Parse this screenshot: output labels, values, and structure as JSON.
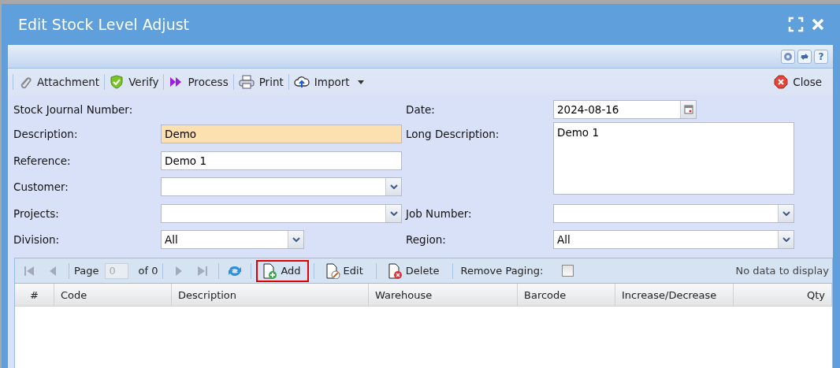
{
  "window": {
    "title": "Edit Stock Level Adjust"
  },
  "header_tools": [
    {
      "kind": "settings"
    },
    {
      "kind": "refresh"
    },
    {
      "kind": "help",
      "label": "?"
    }
  ],
  "toolbar": {
    "items": [
      {
        "kind": "attachment",
        "label": "Attachment"
      },
      {
        "kind": "verify",
        "label": "Verify"
      },
      {
        "kind": "process",
        "label": "Process"
      },
      {
        "kind": "print",
        "label": "Print"
      },
      {
        "kind": "import",
        "label": "Import"
      }
    ],
    "close": {
      "label": "Close"
    }
  },
  "form": {
    "left": [
      {
        "label": "Stock Journal Number:",
        "kind": "none"
      },
      {
        "label": "Description:",
        "kind": "text",
        "value": "Demo",
        "required": true
      },
      {
        "label": "Reference:",
        "kind": "text",
        "value": "Demo 1",
        "required": false
      },
      {
        "label": "Customer:",
        "kind": "combo",
        "required": false
      },
      {
        "label": "Projects:",
        "kind": "combo",
        "required": false
      },
      {
        "label": "Division:",
        "kind": "combo",
        "value": "All",
        "required": false
      }
    ],
    "right": [
      {
        "label": "Date:",
        "kind": "date",
        "value": "2024-08-16"
      },
      {
        "label": "Long Description:",
        "kind": "textarea",
        "value": "Demo 1"
      },
      {
        "label": "Job Number:",
        "kind": "combo"
      },
      {
        "label": "Region:",
        "kind": "combo",
        "value": "All"
      }
    ]
  },
  "grid": {
    "pager": {
      "page_label": "Page",
      "page_value": "0",
      "of_label": "of 0"
    },
    "actions": [
      {
        "kind": "add",
        "label": "Add",
        "highlighted": true
      },
      {
        "kind": "edit",
        "label": "Edit",
        "highlighted": false
      },
      {
        "kind": "delete",
        "label": "Delete",
        "highlighted": false
      }
    ],
    "remove_paging": {
      "label": "Remove Paging:",
      "checked": false
    },
    "status": "No data to display",
    "columns": [
      {
        "label": "#",
        "kind": "index"
      },
      {
        "label": "Code",
        "kind": "text"
      },
      {
        "label": "Description",
        "kind": "text"
      },
      {
        "label": "Warehouse",
        "kind": "text"
      },
      {
        "label": "Barcode",
        "kind": "text"
      },
      {
        "label": "Increase/Decrease",
        "kind": "text"
      },
      {
        "label": "Qty",
        "kind": "number"
      }
    ]
  }
}
